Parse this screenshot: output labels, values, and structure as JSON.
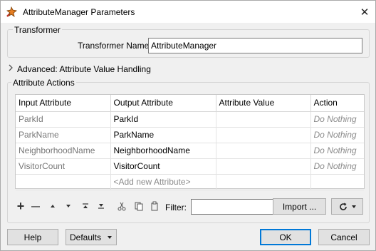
{
  "window": {
    "title": "AttributeManager Parameters",
    "close_glyph": "✕",
    "app_icon": "fme-transformer-icon"
  },
  "transformer_section": {
    "label": "Transformer",
    "name_label": "Transformer Name:",
    "name_value": "AttributeManager"
  },
  "advanced": {
    "label": "Advanced: Attribute Value Handling",
    "expanded": false
  },
  "actions_section": {
    "label": "Attribute Actions",
    "columns": [
      "Input Attribute",
      "Output Attribute",
      "Attribute Value",
      "Action"
    ],
    "rows": [
      {
        "input": "ParkId",
        "output": "ParkId",
        "value": "",
        "action": "Do Nothing"
      },
      {
        "input": "ParkName",
        "output": "ParkName",
        "value": "",
        "action": "Do Nothing"
      },
      {
        "input": "NeighborhoodName",
        "output": "NeighborhoodName",
        "value": "",
        "action": "Do Nothing"
      },
      {
        "input": "VisitorCount",
        "output": "VisitorCount",
        "value": "",
        "action": "Do Nothing"
      }
    ],
    "add_row_placeholder": "<Add new Attribute>"
  },
  "toolbar": {
    "add_icon": "+",
    "remove_icon": "—",
    "filter_label": "Filter:",
    "filter_value": "",
    "import_label": "Import ...",
    "icons": [
      "add-icon",
      "remove-icon",
      "move-up-icon",
      "move-down-icon",
      "move-top-icon",
      "move-bottom-icon",
      "cut-icon",
      "copy-icon",
      "paste-icon",
      "refresh-icon"
    ]
  },
  "footer": {
    "help_label": "Help",
    "defaults_label": "Defaults",
    "ok_label": "OK",
    "cancel_label": "Cancel"
  }
}
